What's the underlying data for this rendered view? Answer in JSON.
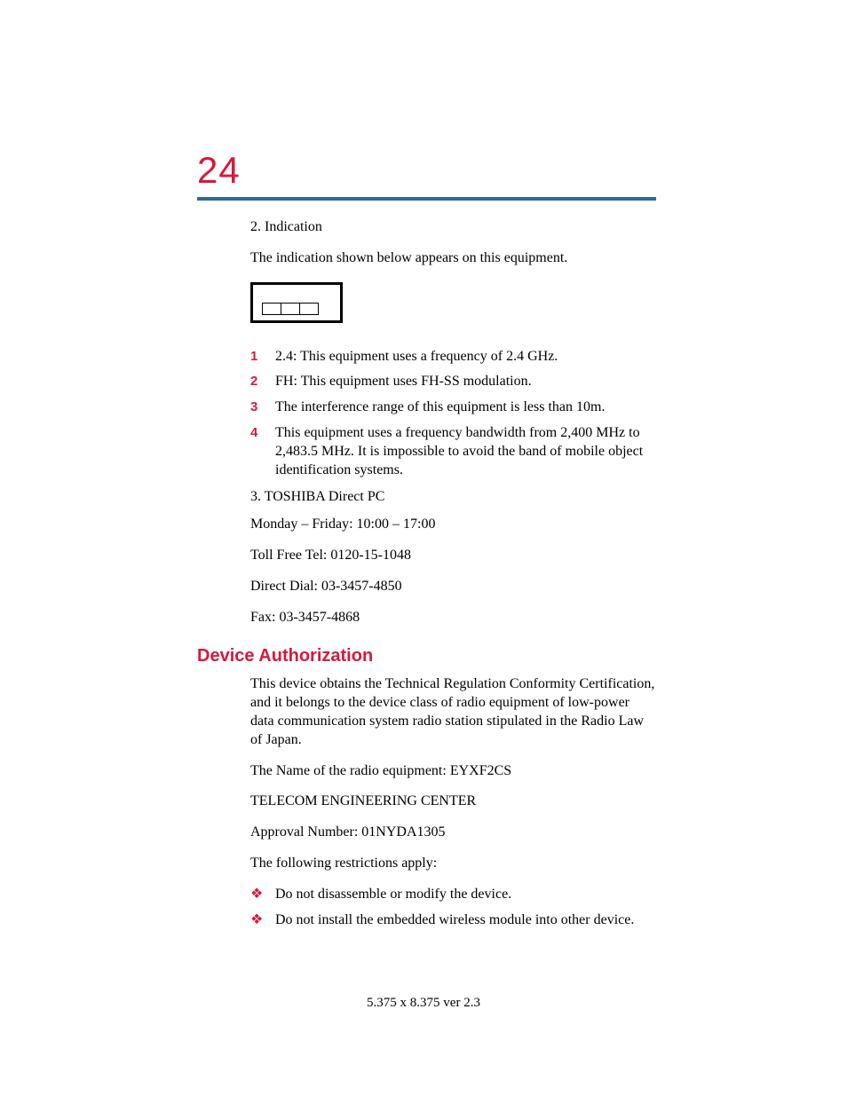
{
  "page_number": "24",
  "section1": {
    "title": "2. Indication",
    "intro": "The indication shown below appears on this equipment.",
    "items": [
      {
        "n": "1",
        "t": "2.4: This equipment uses a frequency of 2.4 GHz."
      },
      {
        "n": "2",
        "t": "FH: This equipment uses FH-SS modulation."
      },
      {
        "n": "3",
        "t": "The interference range of this equipment is less than 10m."
      },
      {
        "n": "4",
        "t": "This equipment uses a frequency bandwidth from 2,400 MHz to 2,483.5 MHz. It is impossible to avoid the band of mobile object identification systems."
      }
    ]
  },
  "section2": {
    "title": "3. TOSHIBA Direct PC",
    "lines": [
      "Monday – Friday: 10:00 – 17:00",
      "Toll Free Tel: 0120-15-1048",
      "Direct Dial: 03-3457-4850",
      "Fax: 03-3457-4868"
    ]
  },
  "heading": "Device Authorization",
  "auth": {
    "p1": "This device obtains the Technical Regulation Conformity Certification, and it belongs to the device class of radio equipment of low-power data communication system radio station stipulated in the Radio Law of Japan.",
    "p2": "The Name of the radio equipment: EYXF2CS",
    "p3": "TELECOM ENGINEERING CENTER",
    "p4": "Approval Number: 01NYDA1305",
    "p5": "The following restrictions apply:",
    "bullets": [
      "Do not disassemble or modify the device.",
      "Do not install the embedded wireless module into other device."
    ]
  },
  "footer": "5.375 x 8.375 ver 2.3"
}
